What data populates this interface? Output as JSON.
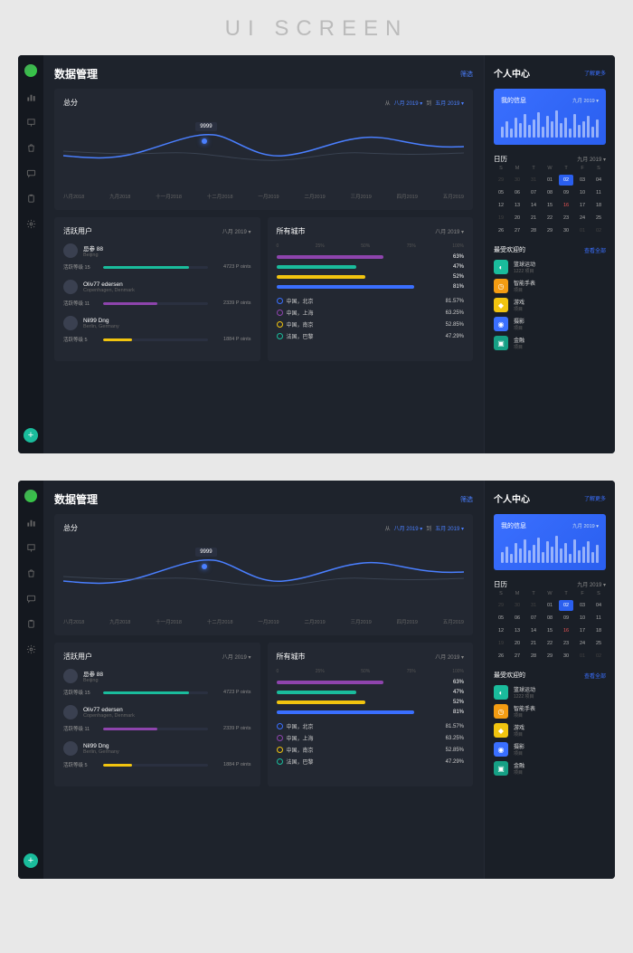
{
  "page_label": "UI SCREEN",
  "header": {
    "title": "数据管理",
    "filter_label": "筛选"
  },
  "sidebar": {
    "fab_label": "+"
  },
  "score_card": {
    "title": "总分",
    "range_from_label": "从",
    "range_to_label": "到",
    "from": "八月 2019 ▾",
    "to": "五月 2019 ▾",
    "tooltip_value": "9999",
    "x_labels": [
      "八月2018",
      "九月2018",
      "十一月2018",
      "十二月2018",
      "一月2019",
      "二月2019",
      "三月2019",
      "四月2019",
      "五月2019"
    ]
  },
  "chart_data": {
    "type": "line",
    "title": "总分",
    "x": [
      "八月2018",
      "九月2018",
      "十一月2018",
      "十二月2018",
      "一月2019",
      "二月2019",
      "三月2019",
      "四月2019",
      "五月2019"
    ],
    "series": [
      {
        "name": "series-a",
        "color": "#4a7fff",
        "values": [
          42,
          38,
          58,
          35,
          40,
          55,
          60,
          50,
          52
        ]
      },
      {
        "name": "series-b",
        "color": "#556",
        "values": [
          50,
          45,
          48,
          42,
          38,
          44,
          52,
          46,
          48
        ]
      }
    ],
    "highlight": {
      "index": 2,
      "value": 9999
    }
  },
  "active_users": {
    "title": "活跃用户",
    "date": "八月 2019 ▾",
    "level_label": "活跃等级",
    "users": [
      {
        "name": "忌参 88",
        "location": "Beijing",
        "level": "15",
        "pct": 82,
        "color": "#1abc9c",
        "points": "4723 P oints"
      },
      {
        "name": "Oliv77 edersen",
        "location": "Copenhagen, Denmark",
        "level": "11",
        "pct": 52,
        "color": "#8e44ad",
        "points": "2339 P oints"
      },
      {
        "name": "Nil99 Dng",
        "location": "Berlin, Germany",
        "level": "5",
        "pct": 28,
        "color": "#f1c40f",
        "points": "1884 P oints"
      }
    ]
  },
  "cities": {
    "title": "所有城市",
    "date": "八月 2019 ▾",
    "scale": [
      "0",
      "25%",
      "50%",
      "75%",
      "100%"
    ],
    "bars": [
      {
        "pct": 63,
        "color": "#8e44ad",
        "label": "63%"
      },
      {
        "pct": 47,
        "color": "#1abc9c",
        "label": "47%"
      },
      {
        "pct": 52,
        "color": "#f1c40f",
        "label": "52%"
      },
      {
        "pct": 81,
        "color": "#3a6fff",
        "label": "81%"
      }
    ],
    "legend": [
      {
        "name": "中国，北京",
        "value": "81.57%",
        "color": "#3a6fff"
      },
      {
        "name": "中国，上海",
        "value": "63.25%",
        "color": "#8e44ad"
      },
      {
        "name": "中国，南京",
        "value": "52.85%",
        "color": "#f1c40f"
      },
      {
        "name": "法国，巴黎",
        "value": "47.29%",
        "color": "#1abc9c"
      }
    ]
  },
  "personal": {
    "title": "个人中心",
    "more": "了解更多",
    "info_title": "我的信息",
    "info_date": "九月 2019 ▾",
    "mini_bars": [
      12,
      18,
      10,
      22,
      16,
      26,
      14,
      20,
      28,
      12,
      24,
      18,
      30,
      16,
      22,
      10,
      26,
      14,
      18,
      24,
      12,
      20
    ]
  },
  "calendar": {
    "title": "日历",
    "date": "九月 2019 ▾",
    "weekdays": [
      "S",
      "M",
      "T",
      "W",
      "T",
      "F",
      "S"
    ],
    "days": [
      {
        "d": "29",
        "muted": true
      },
      {
        "d": "30",
        "muted": true
      },
      {
        "d": "31",
        "muted": true
      },
      {
        "d": "01"
      },
      {
        "d": "02",
        "today": true
      },
      {
        "d": "03"
      },
      {
        "d": "04"
      },
      {
        "d": "05"
      },
      {
        "d": "06"
      },
      {
        "d": "07"
      },
      {
        "d": "08"
      },
      {
        "d": "09"
      },
      {
        "d": "10"
      },
      {
        "d": "11"
      },
      {
        "d": "12"
      },
      {
        "d": "13"
      },
      {
        "d": "14"
      },
      {
        "d": "15"
      },
      {
        "d": "16",
        "red": true
      },
      {
        "d": "17"
      },
      {
        "d": "18"
      },
      {
        "d": "19",
        "muted": true
      },
      {
        "d": "20"
      },
      {
        "d": "21"
      },
      {
        "d": "22"
      },
      {
        "d": "23"
      },
      {
        "d": "24"
      },
      {
        "d": "25"
      },
      {
        "d": "26"
      },
      {
        "d": "27"
      },
      {
        "d": "28"
      },
      {
        "d": "29"
      },
      {
        "d": "30"
      },
      {
        "d": "01",
        "muted": true
      },
      {
        "d": "02",
        "muted": true
      }
    ]
  },
  "popular": {
    "title": "最受欢迎的",
    "view_all": "查看全部",
    "items": [
      {
        "name": "篮球运动",
        "sub": "1222 项目",
        "color": "#1abc9c",
        "icon": "◐"
      },
      {
        "name": "智能手表",
        "sub": "项目",
        "color": "#f39c12",
        "icon": "◷"
      },
      {
        "name": "游戏",
        "sub": "项目",
        "color": "#f1c40f",
        "icon": "◆"
      },
      {
        "name": "摄影",
        "sub": "项目",
        "color": "#3a6fff",
        "icon": "◉"
      },
      {
        "name": "金融",
        "sub": "项目",
        "color": "#16a085",
        "icon": "▣"
      }
    ]
  }
}
